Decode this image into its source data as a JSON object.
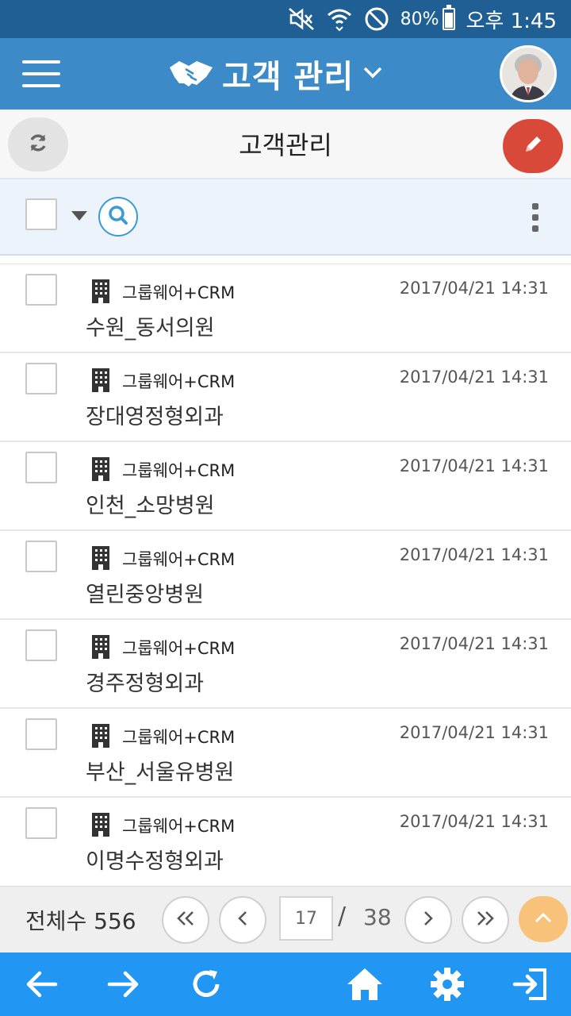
{
  "status_bar": {
    "battery": "80%",
    "time": "오후 1:45",
    "battery_level": 0.8,
    "icons": [
      "mute-icon",
      "wifi-icon",
      "do-not-disturb-icon",
      "battery-icon"
    ]
  },
  "header": {
    "title": "고객 관리",
    "title_icon": "handshake-icon",
    "menu_icon": "hamburger-icon",
    "dropdown_icon": "chevron-down-icon",
    "avatar": "user-avatar"
  },
  "subheader": {
    "title": "고객관리",
    "refresh_icon": "refresh-icon",
    "edit_icon": "pencil-icon"
  },
  "toolbar": {
    "search_icon": "search-icon",
    "more_icon": "more-vertical-icon"
  },
  "list": {
    "items": [
      {
        "category": "그룹웨어+CRM",
        "date": "2017/04/21 14:31",
        "name": "수원_동서의원"
      },
      {
        "category": "그룹웨어+CRM",
        "date": "2017/04/21 14:31",
        "name": "장대영정형외과"
      },
      {
        "category": "그룹웨어+CRM",
        "date": "2017/04/21 14:31",
        "name": "인천_소망병원"
      },
      {
        "category": "그룹웨어+CRM",
        "date": "2017/04/21 14:31",
        "name": "열린중앙병원"
      },
      {
        "category": "그룹웨어+CRM",
        "date": "2017/04/21 14:31",
        "name": "경주정형외과"
      },
      {
        "category": "그룹웨어+CRM",
        "date": "2017/04/21 14:31",
        "name": "부산_서울유병원"
      },
      {
        "category": "그룹웨어+CRM",
        "date": "2017/04/21 14:31",
        "name": "이명수정형외과"
      }
    ]
  },
  "pager": {
    "total_label": "전체수 556",
    "current_page": "17",
    "slash": "/",
    "total_pages": "38"
  },
  "bottom_nav": {
    "icons": [
      "back-arrow-icon",
      "forward-arrow-icon",
      "reload-icon",
      "home-icon",
      "settings-icon",
      "logout-icon"
    ]
  },
  "colors": {
    "status_bar": "#1f5f93",
    "app_bar": "#3c8ac7",
    "edit_button": "#d9493a",
    "bottom_nav": "#2196f3",
    "scroll_top": "#f8c27a"
  }
}
